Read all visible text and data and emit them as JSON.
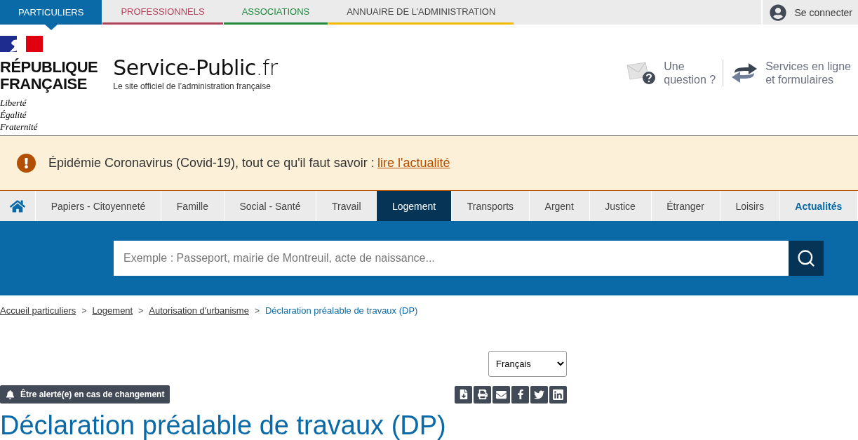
{
  "audience_tabs": [
    {
      "label": "PARTICULIERS",
      "selected": true,
      "color": "#0a6aa8"
    },
    {
      "label": "PROFESSIONNELS",
      "selected": false,
      "color": "#b4425a"
    },
    {
      "label": "ASSOCIATIONS",
      "selected": false,
      "color": "#1f8a3e"
    },
    {
      "label": "ANNUAIRE DE L’ADMINISTRATION",
      "selected": false,
      "color": "#f3b800"
    }
  ],
  "account": {
    "label": "Se connecter"
  },
  "brand": {
    "republic": [
      "RÉPUBLIQUE",
      "FRANÇAISE"
    ],
    "motto": [
      "Liberté",
      "Égalité",
      "Fraternité"
    ],
    "site_name": "Service-Public",
    "site_suffix": ".fr",
    "tagline": "Le site officiel de l’administration française"
  },
  "header_links": [
    {
      "kind": "question",
      "lines": [
        "Une",
        "question ?"
      ]
    },
    {
      "kind": "services",
      "lines": [
        "Services en ligne",
        "et formulaires"
      ]
    }
  ],
  "alert": {
    "text": "Épidémie Coronavirus (Covid-19), tout ce qu'il faut savoir :",
    "link": "lire l'actualité"
  },
  "nav": [
    {
      "kind": "home",
      "selected": false
    },
    {
      "kind": "item",
      "label": "Papiers - Citoyenneté",
      "selected": false
    },
    {
      "kind": "item",
      "label": "Famille",
      "selected": false
    },
    {
      "kind": "item",
      "label": "Social - Santé",
      "selected": false
    },
    {
      "kind": "item",
      "label": "Travail",
      "selected": false
    },
    {
      "kind": "item",
      "label": "Logement",
      "selected": true
    },
    {
      "kind": "item",
      "label": "Transports",
      "selected": false
    },
    {
      "kind": "item",
      "label": "Argent",
      "selected": false
    },
    {
      "kind": "item",
      "label": "Justice",
      "selected": false
    },
    {
      "kind": "item",
      "label": "Étranger",
      "selected": false
    },
    {
      "kind": "item",
      "label": "Loisirs",
      "selected": false
    },
    {
      "kind": "highlight",
      "label": "Actualités",
      "selected": false
    }
  ],
  "search": {
    "placeholder": "Exemple : Passeport, mairie de Montreuil, acte de naissance..."
  },
  "breadcrumb": [
    {
      "label": "Accueil particuliers",
      "current": false
    },
    {
      "label": "Logement",
      "current": false
    },
    {
      "label": "Autorisation d'urbanisme",
      "current": false
    },
    {
      "label": "Déclaration préalable de travaux (DP)",
      "current": true
    }
  ],
  "breadcrumb_separator": ">",
  "language": {
    "value": "Français"
  },
  "alert_button": {
    "label": "Être alerté(e) en cas de changement"
  },
  "share_tools": [
    {
      "kind": "download"
    },
    {
      "kind": "print"
    },
    {
      "kind": "mail"
    },
    {
      "kind": "facebook"
    },
    {
      "kind": "twitter"
    },
    {
      "kind": "linkedin"
    }
  ],
  "page_title": "Déclaration préalable de travaux (DP)"
}
